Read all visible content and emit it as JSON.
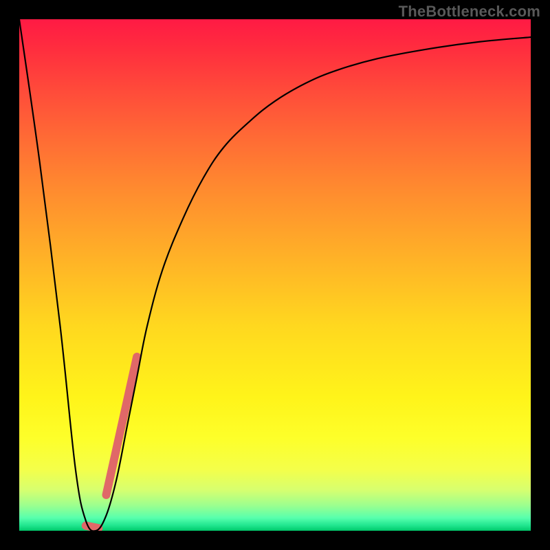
{
  "watermark": "TheBottleneck.com",
  "chart_data": {
    "type": "line",
    "title": "",
    "xlabel": "",
    "ylabel": "",
    "xlim": [
      0,
      100
    ],
    "ylim": [
      0,
      100
    ],
    "grid": false,
    "background": "vertical-gradient-red-to-green",
    "series": [
      {
        "name": "bottleneck-curve",
        "x": [
          0,
          4,
          8,
          11,
          13,
          15,
          17,
          19,
          21,
          23,
          25,
          28,
          32,
          36,
          40,
          45,
          50,
          56,
          62,
          70,
          80,
          90,
          100
        ],
        "y": [
          100,
          72,
          40,
          12,
          2,
          0,
          3,
          10,
          20,
          30,
          40,
          51,
          61,
          69,
          75,
          80,
          84,
          87.5,
          90,
          92.3,
          94.2,
          95.6,
          96.5
        ]
      }
    ],
    "highlights": [
      {
        "name": "segment-rising",
        "x": [
          17,
          23
        ],
        "y": [
          7,
          34
        ]
      },
      {
        "name": "segment-trough",
        "x": [
          13,
          15.5
        ],
        "y": [
          1,
          0.5
        ]
      }
    ],
    "notes": "Axes are unlabeled in the source image; x and y are normalized 0–100 read off the frame. Curve plunges from top-left to a minimum near x≈15 then rises asymptotically toward ~96."
  }
}
